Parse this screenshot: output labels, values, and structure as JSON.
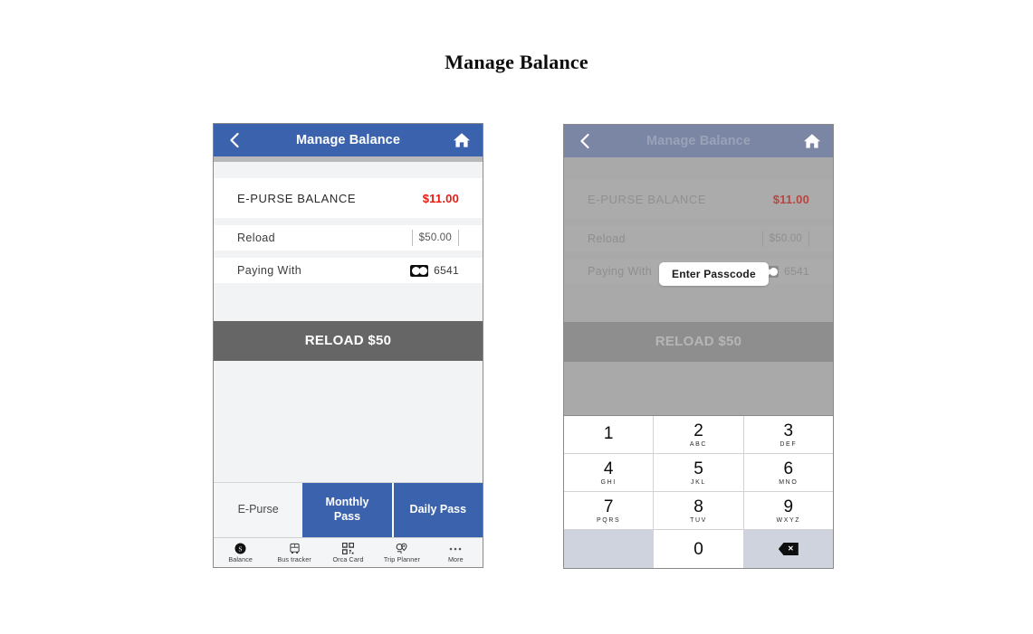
{
  "page": {
    "title": "Manage Balance"
  },
  "left_screen": {
    "header": {
      "title": "Manage Balance",
      "back_icon": "chevron-left-icon",
      "home_icon": "home-icon"
    },
    "balance_row": {
      "label": "E-PURSE BALANCE",
      "value": "$11.00",
      "value_color": "#e81b14"
    },
    "reload_row": {
      "label": "Reload",
      "amount": "$50.00"
    },
    "paying_row": {
      "label": "Paying  With",
      "card_icon": "mastercard-icon",
      "card_digits": "6541"
    },
    "reload_button": {
      "label": "RELOAD $50"
    },
    "pass_tabs": [
      {
        "label": "E-Purse",
        "active": false
      },
      {
        "label": "Monthly Pass",
        "line1": "Monthly",
        "line2": "Pass",
        "active": true
      },
      {
        "label": "Daily Pass",
        "active": true
      }
    ],
    "bottom_nav": [
      {
        "label": "Balance",
        "icon": "dollar-coin-icon"
      },
      {
        "label": "Bus tracker",
        "icon": "bus-icon"
      },
      {
        "label": "Orca Card",
        "icon": "qr-code-icon"
      },
      {
        "label": "Trip Planner",
        "icon": "map-pin-icon"
      },
      {
        "label": "More",
        "icon": "ellipsis-icon"
      }
    ]
  },
  "right_screen": {
    "header": {
      "title": "Manage Balance",
      "back_icon": "chevron-left-icon",
      "home_icon": "home-icon"
    },
    "balance_row": {
      "label": "E-PURSE BALANCE",
      "value": "$11.00"
    },
    "reload_row": {
      "label": "Reload",
      "amount": "$50.00"
    },
    "paying_row": {
      "label": "Paying  With",
      "card_digits": "6541"
    },
    "reload_button": {
      "label": "RELOAD $50"
    },
    "passcode_tooltip": {
      "label": "Enter Passcode"
    },
    "keypad": {
      "rows": [
        [
          {
            "num": "1",
            "sub": ""
          },
          {
            "num": "2",
            "sub": "ABC"
          },
          {
            "num": "3",
            "sub": "DEF"
          }
        ],
        [
          {
            "num": "4",
            "sub": "GHI"
          },
          {
            "num": "5",
            "sub": "JKL"
          },
          {
            "num": "6",
            "sub": "MNO"
          }
        ],
        [
          {
            "num": "7",
            "sub": "PQRS"
          },
          {
            "num": "8",
            "sub": "TUV"
          },
          {
            "num": "9",
            "sub": "WXYZ"
          }
        ]
      ],
      "zero": {
        "num": "0",
        "sub": ""
      },
      "delete_icon": "backspace-icon"
    }
  },
  "colors": {
    "header_blue": "#3b63ad",
    "tab_blue": "#3b63ad",
    "reload_gray": "#666666",
    "balance_red": "#e81b14",
    "dim_overlay": "#a9a9a9"
  }
}
